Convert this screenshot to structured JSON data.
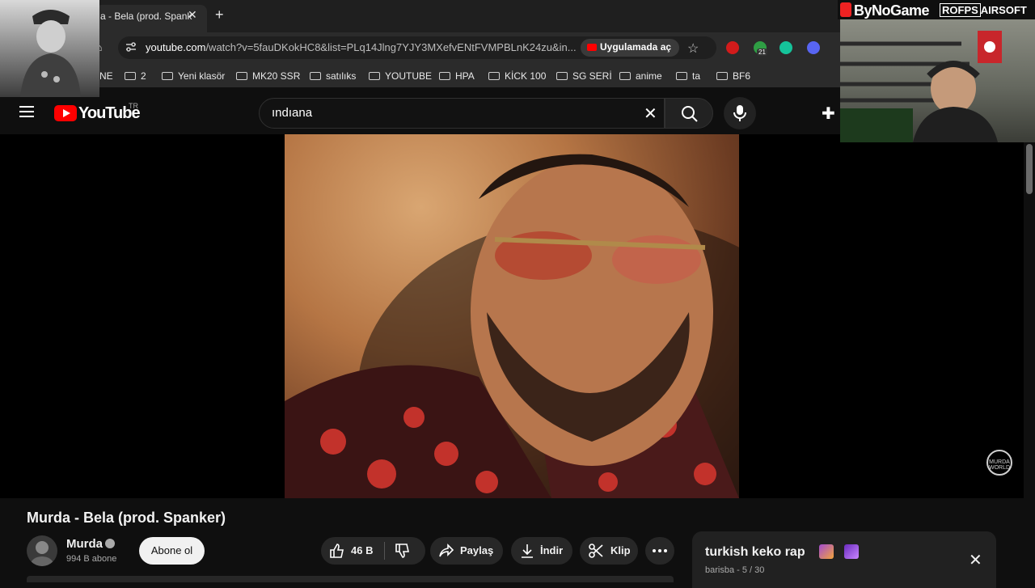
{
  "browser": {
    "tab_title": "a - Bela (prod. Spank",
    "url_host": "youtube.com",
    "url_rest": "/watch?v=5fauDKokHC8&list=PLq14Jlng7YJY3MXefvENtFVMPBLnK24zu&in...",
    "open_in_app": "Uygulamada aç",
    "extension_badge": "21",
    "bookmarks": [
      "NE",
      "2",
      "Yeni klasör",
      "MK20 SSR",
      "satılıks",
      "YOUTUBE",
      "HPA",
      "KİCK 100",
      "SG SERİ",
      "anime",
      "ta",
      "BF6"
    ]
  },
  "youtube": {
    "logo_text": "YouTube",
    "country": "TR",
    "search_query": "ındıana"
  },
  "video": {
    "title": "Murda - Bela (prod. Spanker)",
    "channel": "Murda",
    "subscribers": "994 B abone",
    "subscribe_label": "Abone ol",
    "likes": "46 B",
    "share_label": "Paylaş",
    "download_label": "İndir",
    "clip_label": "Klip",
    "watermark": "MURDA WORLD"
  },
  "playlist": {
    "title": "turkish keko rap",
    "owner_progress": "barisba - 5 / 30"
  },
  "overlay": {
    "brand": "ByNoGame",
    "sponsor_box": "ROFPS",
    "sponsor_rest": "AIRSOFT"
  },
  "colors": {
    "youtube_red": "#ff0000",
    "background": "#0f0f0f",
    "pill": "#272727"
  }
}
